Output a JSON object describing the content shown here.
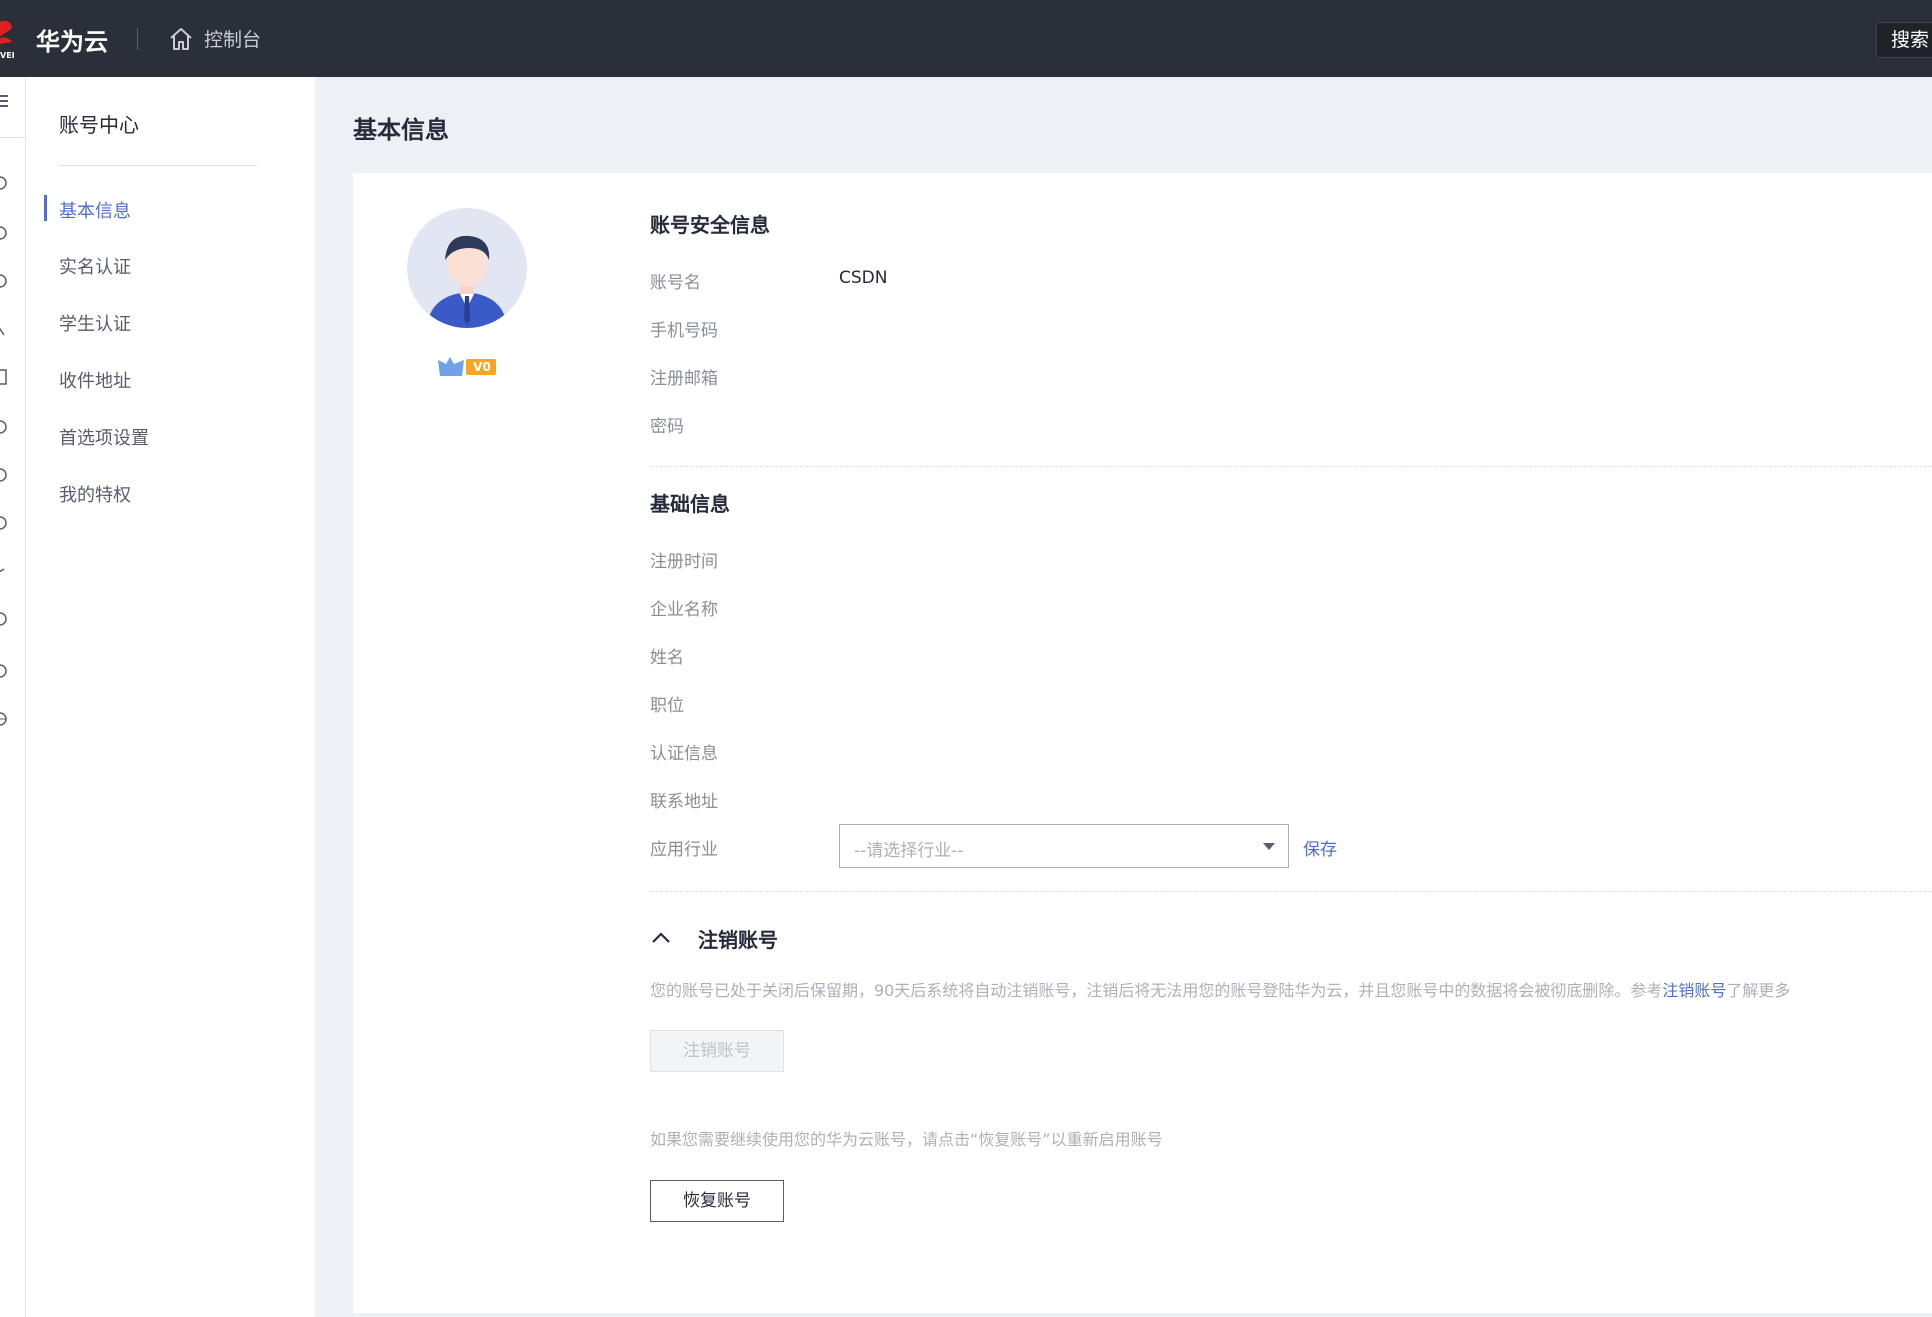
{
  "topbar": {
    "brand": "华为云",
    "console_label": "控制台",
    "search_label": "搜索"
  },
  "sidenav": {
    "title": "账号中心",
    "items": [
      {
        "label": "基本信息",
        "active": true
      },
      {
        "label": "实名认证",
        "active": false
      },
      {
        "label": "学生认证",
        "active": false
      },
      {
        "label": "收件地址",
        "active": false
      },
      {
        "label": "首选项设置",
        "active": false
      },
      {
        "label": "我的特权",
        "active": false
      }
    ]
  },
  "main": {
    "page_title": "基本信息",
    "vip_level": "V0",
    "security": {
      "title": "账号安全信息",
      "fields": [
        {
          "label": "账号名",
          "value": "CSDN"
        },
        {
          "label": "手机号码",
          "value": ""
        },
        {
          "label": "注册邮箱",
          "value": ""
        },
        {
          "label": "密码",
          "value": ""
        }
      ]
    },
    "basic": {
      "title": "基础信息",
      "fields": [
        {
          "label": "注册时间",
          "value": ""
        },
        {
          "label": "企业名称",
          "value": ""
        },
        {
          "label": "姓名",
          "value": ""
        },
        {
          "label": "职位",
          "value": ""
        },
        {
          "label": "认证信息",
          "value": ""
        },
        {
          "label": "联系地址",
          "value": ""
        }
      ],
      "industry": {
        "label": "应用行业",
        "placeholder": "--请选择行业--",
        "save_label": "保存"
      }
    },
    "cancel": {
      "title": "注销账号",
      "notice_before": "您的账号已处于关闭后保留期，90天后系统将自动注销账号，注销后将无法用您的账号登陆华为云，并且您账号中的数据将会被彻底删除。参考",
      "notice_link": "注销账号",
      "notice_after": "了解更多",
      "cancel_button": "注销账号",
      "restore_hint": "如果您需要继续使用您的华为云账号，请点击“恢复账号”以重新启用账号",
      "restore_button": "恢复账号"
    }
  },
  "colors": {
    "topbar_bg": "#2b2f3a",
    "accent": "#526ecc",
    "page_bg": "#eef0f5"
  }
}
